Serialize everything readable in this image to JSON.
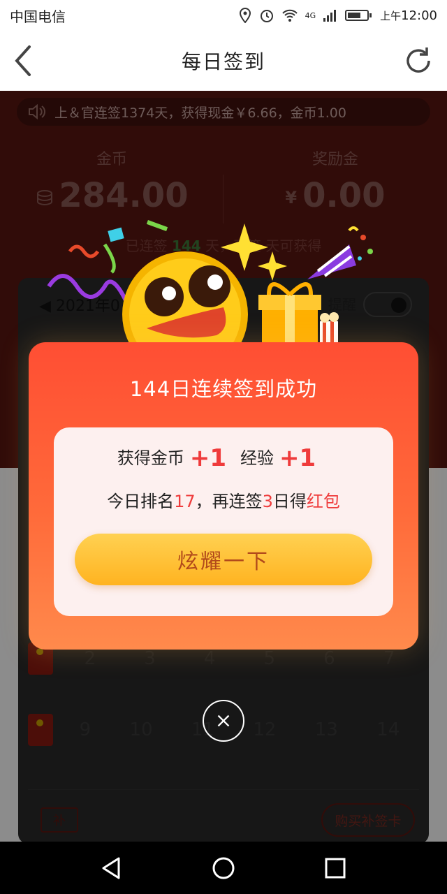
{
  "status_bar": {
    "carrier": "中国电信",
    "network": "4G",
    "time_prefix": "上午",
    "time": "12:00"
  },
  "titlebar": {
    "title": "每日签到"
  },
  "ticker": {
    "text": "上＆官连签1374天，获得现金￥6.66，金币1.00"
  },
  "stats": {
    "coins_label": "金币",
    "coins_value": "284.00",
    "bonus_label": "奖励金",
    "bonus_prefix": "¥",
    "bonus_value": "0.00"
  },
  "streak": {
    "prefix": "已连签",
    "days": "144",
    "suffix": "天，再签",
    "tail": "天可获得"
  },
  "calendar": {
    "month": "2021年0",
    "remind_label": "提醒",
    "week2": [
      "2",
      "3",
      "4",
      "5",
      "6",
      "7"
    ],
    "week3": [
      "9",
      "10",
      "11",
      "12",
      "13",
      "14"
    ],
    "makeup_icon_text": "补",
    "buy_card_label": "购买补签卡"
  },
  "modal": {
    "title": "144日连续签到成功",
    "coins_label": "获得金币",
    "coins_plus": "+1",
    "exp_label": "经验",
    "exp_plus": "+1",
    "rank_prefix": "今日排名",
    "rank_value": "17",
    "rank_middle": "，再连签",
    "days_more": "3",
    "rank_suffix": "日得",
    "reward": "红包",
    "show_off_label": "炫耀一下"
  },
  "colors": {
    "accent_red": "#ef3b3b",
    "modal_top": "#ff4e33",
    "button_gold": "#ffb320"
  },
  "icons": [
    "back-icon",
    "refresh-icon",
    "speaker-icon",
    "coin-stack-icon",
    "close-icon",
    "nav-back-icon",
    "nav-home-icon",
    "nav-recents-icon"
  ]
}
